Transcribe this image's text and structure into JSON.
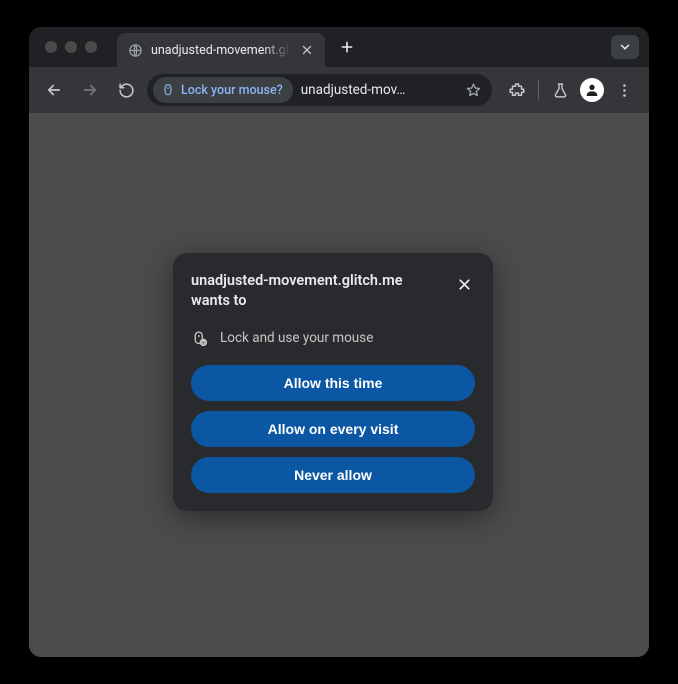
{
  "tab": {
    "title": "unadjusted-movement.glitch."
  },
  "omnibox": {
    "chip_label": "Lock your mouse?",
    "url_display": "unadjusted-mov…"
  },
  "dialog": {
    "title": "unadjusted-movement.glitch.me wants to",
    "permission_label": "Lock and use your mouse",
    "buttons": {
      "allow_once": "Allow this time",
      "allow_always": "Allow on every visit",
      "never": "Never allow"
    }
  }
}
